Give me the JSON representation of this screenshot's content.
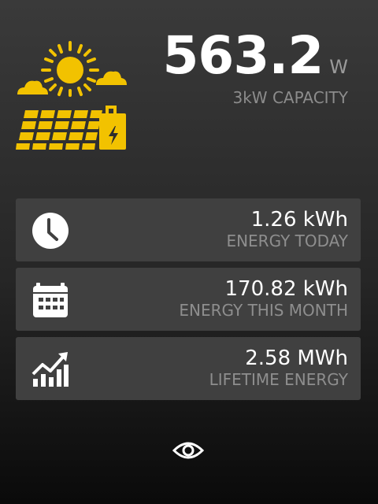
{
  "power": {
    "value": "563.2",
    "unit": "W",
    "capacity": "3kW CAPACITY"
  },
  "stats": [
    {
      "icon": "clock-icon",
      "value": "1.26 kWh",
      "label": "ENERGY TODAY"
    },
    {
      "icon": "calendar-icon",
      "value": "170.82 kWh",
      "label": "ENERGY THIS MONTH"
    },
    {
      "icon": "growth-chart-icon",
      "value": "2.58 MWh",
      "label": "LIFETIME ENERGY"
    }
  ],
  "colors": {
    "accent": "#F2C200",
    "card": "#404040",
    "muted": "#8E8E8E"
  }
}
